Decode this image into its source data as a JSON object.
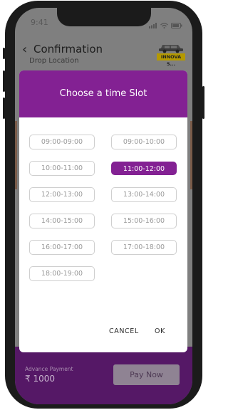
{
  "status_bar": {
    "time": "9:41"
  },
  "header": {
    "title": "Confirmation",
    "car_label": "INNOVA 5..."
  },
  "background_peek_text": "Drop Location",
  "dialog": {
    "title": "Choose a time Slot",
    "slots": [
      {
        "label": "09:00-09:00",
        "selected": false
      },
      {
        "label": "09:00-10:00",
        "selected": false
      },
      {
        "label": "10:00-11:00",
        "selected": false
      },
      {
        "label": "11:00-12:00",
        "selected": true
      },
      {
        "label": "12:00-13:00",
        "selected": false
      },
      {
        "label": "13:00-14:00",
        "selected": false
      },
      {
        "label": "14:00-15:00",
        "selected": false
      },
      {
        "label": "15:00-16:00",
        "selected": false
      },
      {
        "label": "16:00-17:00",
        "selected": false
      },
      {
        "label": "17:00-18:00",
        "selected": false
      },
      {
        "label": "18:00-19:00",
        "selected": false
      }
    ],
    "cancel_label": "CANCEL",
    "ok_label": "OK"
  },
  "bottom_bar": {
    "advance_label": "Advance Payment",
    "amount": "₹ 1000",
    "pay_button": "Pay Now"
  },
  "colors": {
    "accent": "#832193",
    "bottom_bar": "#551866",
    "overlay": "#7f7f7f"
  }
}
